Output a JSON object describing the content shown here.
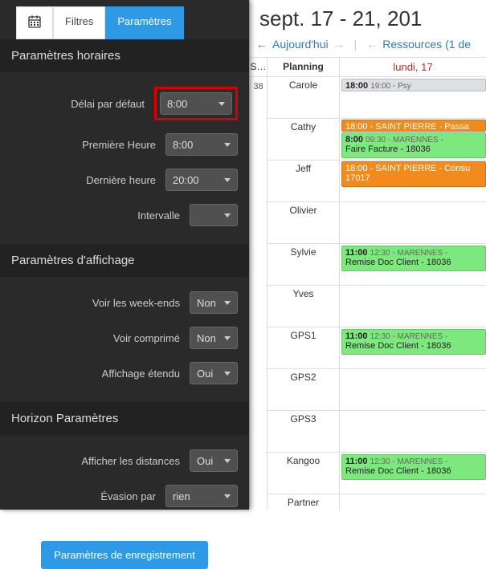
{
  "tabs": {
    "filtres": "Filtres",
    "parametres": "Paramètres"
  },
  "sections": {
    "horaires": {
      "title": "Paramètres horaires"
    },
    "affichage": {
      "title": "Paramètres d'affichage"
    },
    "horizon": {
      "title": "Horizon Paramètres"
    }
  },
  "horaires": {
    "delai_label": "Délai par défaut",
    "delai_value": "8:00",
    "premiere_label": "Première Heure",
    "premiere_value": "8:00",
    "derniere_label": "Dernière heure",
    "derniere_value": "20:00",
    "intervalle_label": "Intervalle",
    "intervalle_value": ""
  },
  "affichage": {
    "weekends_label": "Voir les week-ends",
    "weekends_value": "Non",
    "comprime_label": "Voir comprimé",
    "comprime_value": "Non",
    "etendu_label": "Affichage étendu",
    "etendu_value": "Oui"
  },
  "horizon": {
    "distances_label": "Afficher les distances",
    "distances_value": "Oui",
    "evasion_label": "Évasion par",
    "evasion_value": "rien"
  },
  "save_button": "Paramètres de enregistrement",
  "calendar": {
    "title": "sept. 17 - 21, 201",
    "today": "Aujourd'hui",
    "resources": "Ressources (1 de",
    "header_s": "S…",
    "header_planning": "Planning",
    "header_day": "lundi, 17",
    "time_marker": "38",
    "rows": [
      {
        "name": "Carole"
      },
      {
        "name": "Cathy"
      },
      {
        "name": "Jeff"
      },
      {
        "name": "Olivier"
      },
      {
        "name": "Sylvie"
      },
      {
        "name": "Yves"
      },
      {
        "name": "GPS1"
      },
      {
        "name": "GPS2"
      },
      {
        "name": "GPS3"
      },
      {
        "name": "Kangoo"
      },
      {
        "name": "Partner"
      }
    ],
    "events": {
      "carole": {
        "t1": "18:00",
        "t2": "19:00 - Psy"
      },
      "cathy1": {
        "text": "18:00 - SAINT PIERRE - Passa"
      },
      "cathy2": {
        "t1": "8:00",
        "t2": "09:30 - MARENNES - ",
        "line2": "Faire Facture - 18036"
      },
      "jeff": {
        "text": "18:00 - SAINT PIERRE - Consu",
        "line2": "17017"
      },
      "sylvie": {
        "t1": "11:00",
        "t2": "12:30 - MARENNES - ",
        "line2": "Remise Doc Client - 18036"
      },
      "gps1": {
        "t1": "11:00",
        "t2": "12:30 - MARENNES - ",
        "line2": "Remise Doc Client - 18036"
      },
      "kangoo": {
        "t1": "11:00",
        "t2": "12:30 - MARENNES - ",
        "line2": "Remise Doc Client - 18036"
      }
    }
  }
}
